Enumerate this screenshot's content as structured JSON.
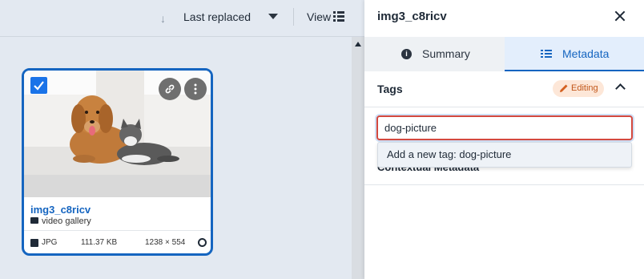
{
  "toolbar": {
    "sort_label": "Last replaced",
    "view_label": "View"
  },
  "card": {
    "title": "img3_c8ricv",
    "folder": "video gallery",
    "file_type": "JPG",
    "file_size": "111.37 KB",
    "dimensions": "1238 × 554",
    "selected": true
  },
  "panel": {
    "title": "img3_c8ricv",
    "tabs": [
      {
        "label": "Summary",
        "active": false
      },
      {
        "label": "Metadata",
        "active": true
      }
    ],
    "tags_section": {
      "label": "Tags",
      "badge": "Editing",
      "input_value": "dog-picture",
      "suggestion": "Add a new tag: dog-picture"
    },
    "contextual_metadata_label": "Contextual Metadata"
  },
  "colors": {
    "accent": "#1565c0",
    "editing_badge_bg": "#fde7d8",
    "editing_badge_text": "#c2571a",
    "input_error_border": "#d4493f"
  }
}
